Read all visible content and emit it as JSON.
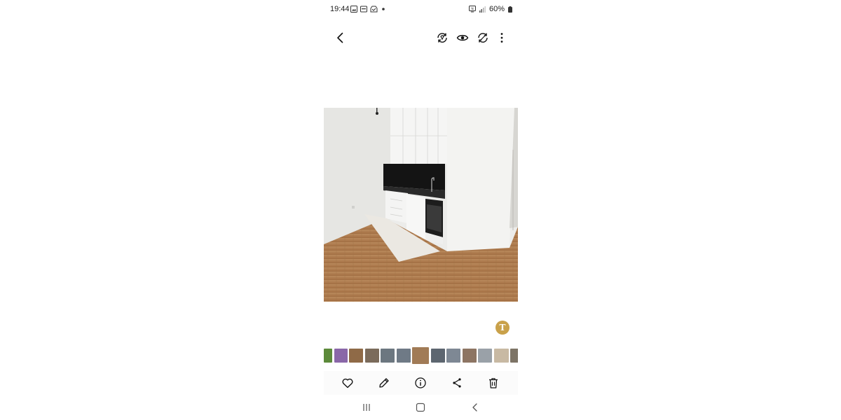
{
  "status_bar": {
    "time": "19:44",
    "battery": "60%",
    "notification_icons": [
      "gallery-icon",
      "cast-icon",
      "tray-icon",
      "dot-icon"
    ],
    "system_icons": [
      "nfc-icon",
      "signal-icon",
      "battery-icon"
    ]
  },
  "top_bar": {
    "icons": [
      "back-icon",
      "remaster-icon",
      "view-icon",
      "auto-rotate-icon",
      "more-icon"
    ]
  },
  "photo": {
    "subject": "kitchen"
  },
  "text_extract": {
    "label": "T"
  },
  "filmstrip": {
    "thumbnails": [
      {
        "color": "#5c8a3a"
      },
      {
        "color": "#8a67a8"
      },
      {
        "color": "#8f6a47"
      },
      {
        "color": "#7b6b5b"
      },
      {
        "color": "#6c7780"
      },
      {
        "color": "#6f7a86"
      },
      {
        "color": "#a17b56"
      },
      {
        "color": "#5d6670"
      },
      {
        "color": "#7e8894"
      },
      {
        "color": "#8d7563"
      },
      {
        "color": "#9aa1a8"
      },
      {
        "color": "#c8b9a3"
      },
      {
        "color": "#7d7466"
      }
    ]
  },
  "bottom_actions": {
    "icons": [
      "heart-icon",
      "edit-icon",
      "info-icon",
      "share-icon",
      "delete-icon"
    ]
  },
  "nav_bar": {
    "icons": [
      "recents-icon",
      "home-icon",
      "nav-back-icon"
    ]
  }
}
